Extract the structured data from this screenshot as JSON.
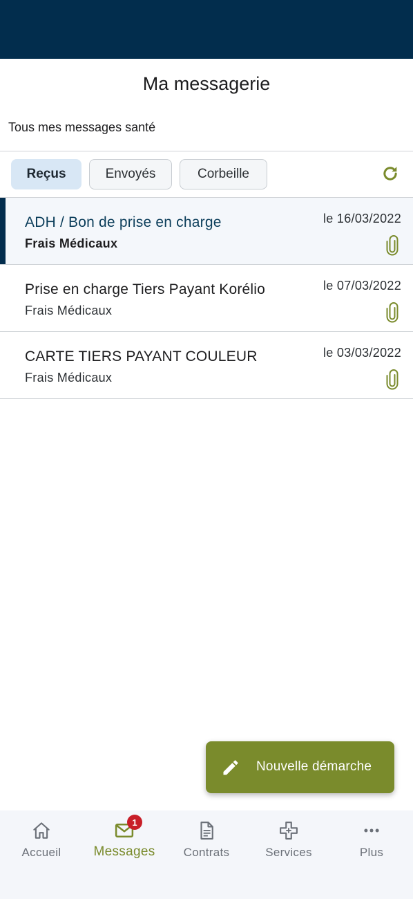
{
  "header": {
    "title": "Ma messagerie"
  },
  "subtitle": "Tous mes messages santé",
  "tabs": [
    {
      "label": "Reçus",
      "active": true
    },
    {
      "label": "Envoyés",
      "active": false
    },
    {
      "label": "Corbeille",
      "active": false
    }
  ],
  "refresh_icon": "refresh-icon",
  "messages": [
    {
      "title": "ADH / Bon de prise en charge",
      "category": "Frais Médicaux",
      "date": "le 16/03/2022",
      "has_attachment": true,
      "selected": true
    },
    {
      "title": "Prise en charge Tiers Payant Korélio",
      "category": "Frais Médicaux",
      "date": "le 07/03/2022",
      "has_attachment": true,
      "selected": false
    },
    {
      "title": "CARTE TIERS PAYANT COULEUR",
      "category": "Frais Médicaux",
      "date": "le 03/03/2022",
      "has_attachment": true,
      "selected": false
    }
  ],
  "fab": {
    "label": "Nouvelle démarche",
    "icon": "pencil-icon"
  },
  "nav": [
    {
      "label": "Accueil",
      "icon": "home-icon",
      "active": false
    },
    {
      "label": "Messages",
      "icon": "mail-icon",
      "active": true,
      "badge": "1"
    },
    {
      "label": "Contrats",
      "icon": "document-icon",
      "active": false
    },
    {
      "label": "Services",
      "icon": "health-cross-icon",
      "active": false
    },
    {
      "label": "Plus",
      "icon": "more-icon",
      "active": false
    }
  ],
  "colors": {
    "brand_dark": "#022d4d",
    "accent_green": "#7a8b2c",
    "badge_red": "#c81e28",
    "tab_active": "#d8e7f5"
  }
}
